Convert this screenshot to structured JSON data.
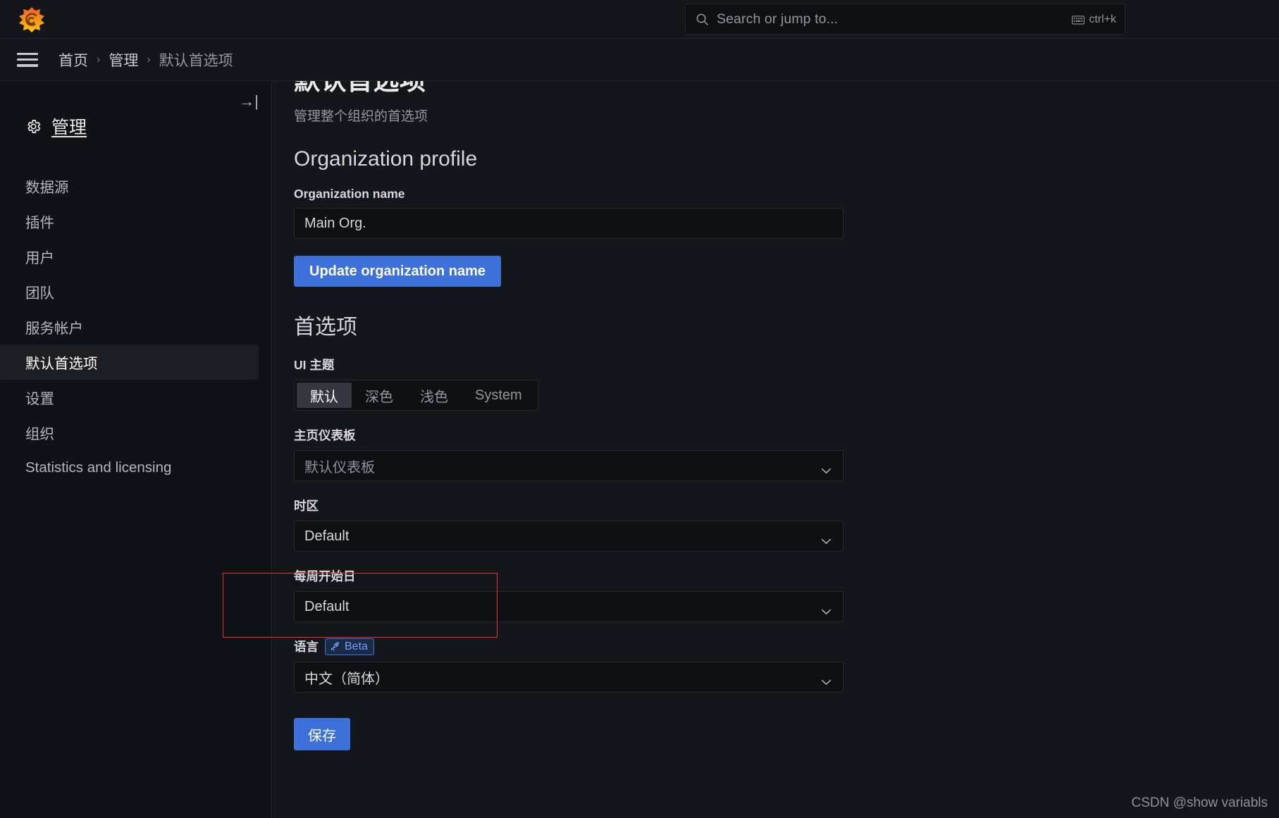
{
  "topbar": {
    "logo_name": "grafana-logo",
    "search": {
      "placeholder": "Search or jump to...",
      "icon": "search-icon"
    },
    "shortcut": {
      "label": "ctrl+k",
      "icon": "keyboard-icon"
    }
  },
  "breadcrumb": {
    "menu_icon": "hamburger-menu-icon",
    "separator": "›",
    "items": [
      "首页",
      "管理",
      "默认首选项"
    ]
  },
  "sidebar": {
    "collapse_label": "→|",
    "header": {
      "icon": "gear-icon",
      "label": "管理"
    },
    "items": [
      {
        "label": "数据源",
        "active": false
      },
      {
        "label": "插件",
        "active": false
      },
      {
        "label": "用户",
        "active": false
      },
      {
        "label": "团队",
        "active": false
      },
      {
        "label": "服务帐户",
        "active": false
      },
      {
        "label": "默认首选项",
        "active": true
      },
      {
        "label": "设置",
        "active": false
      },
      {
        "label": "组织",
        "active": false
      },
      {
        "label": "Statistics and licensing",
        "active": false
      }
    ],
    "active_indicator_color": "#f55f3e"
  },
  "main": {
    "title": "默认首选项",
    "subtitle": "管理整个组织的首选项",
    "org_profile": {
      "heading": "Organization profile",
      "name_label": "Organization name",
      "name_value": "Main Org.",
      "update_button": "Update organization name"
    },
    "preferences": {
      "heading": "首选项",
      "theme": {
        "label": "UI 主题",
        "options": [
          "默认",
          "深色",
          "浅色",
          "System"
        ],
        "selected": "默认"
      },
      "home_dashboard": {
        "label": "主页仪表板",
        "placeholder": "默认仪表板"
      },
      "timezone": {
        "label": "时区",
        "value": "Default"
      },
      "week_start": {
        "label": "每周开始日",
        "value": "Default"
      },
      "language": {
        "label": "语言",
        "badge": "Beta",
        "badge_icon": "rocket-icon",
        "value": "中文（简体）"
      },
      "save_button": "保存"
    }
  },
  "colors": {
    "accent_blue": "#3d71d9",
    "active_orange": "#f55f3e",
    "highlight_red": "#e8312f",
    "beta_blue": "#6e9fff"
  },
  "watermark": "CSDN @show variabls"
}
